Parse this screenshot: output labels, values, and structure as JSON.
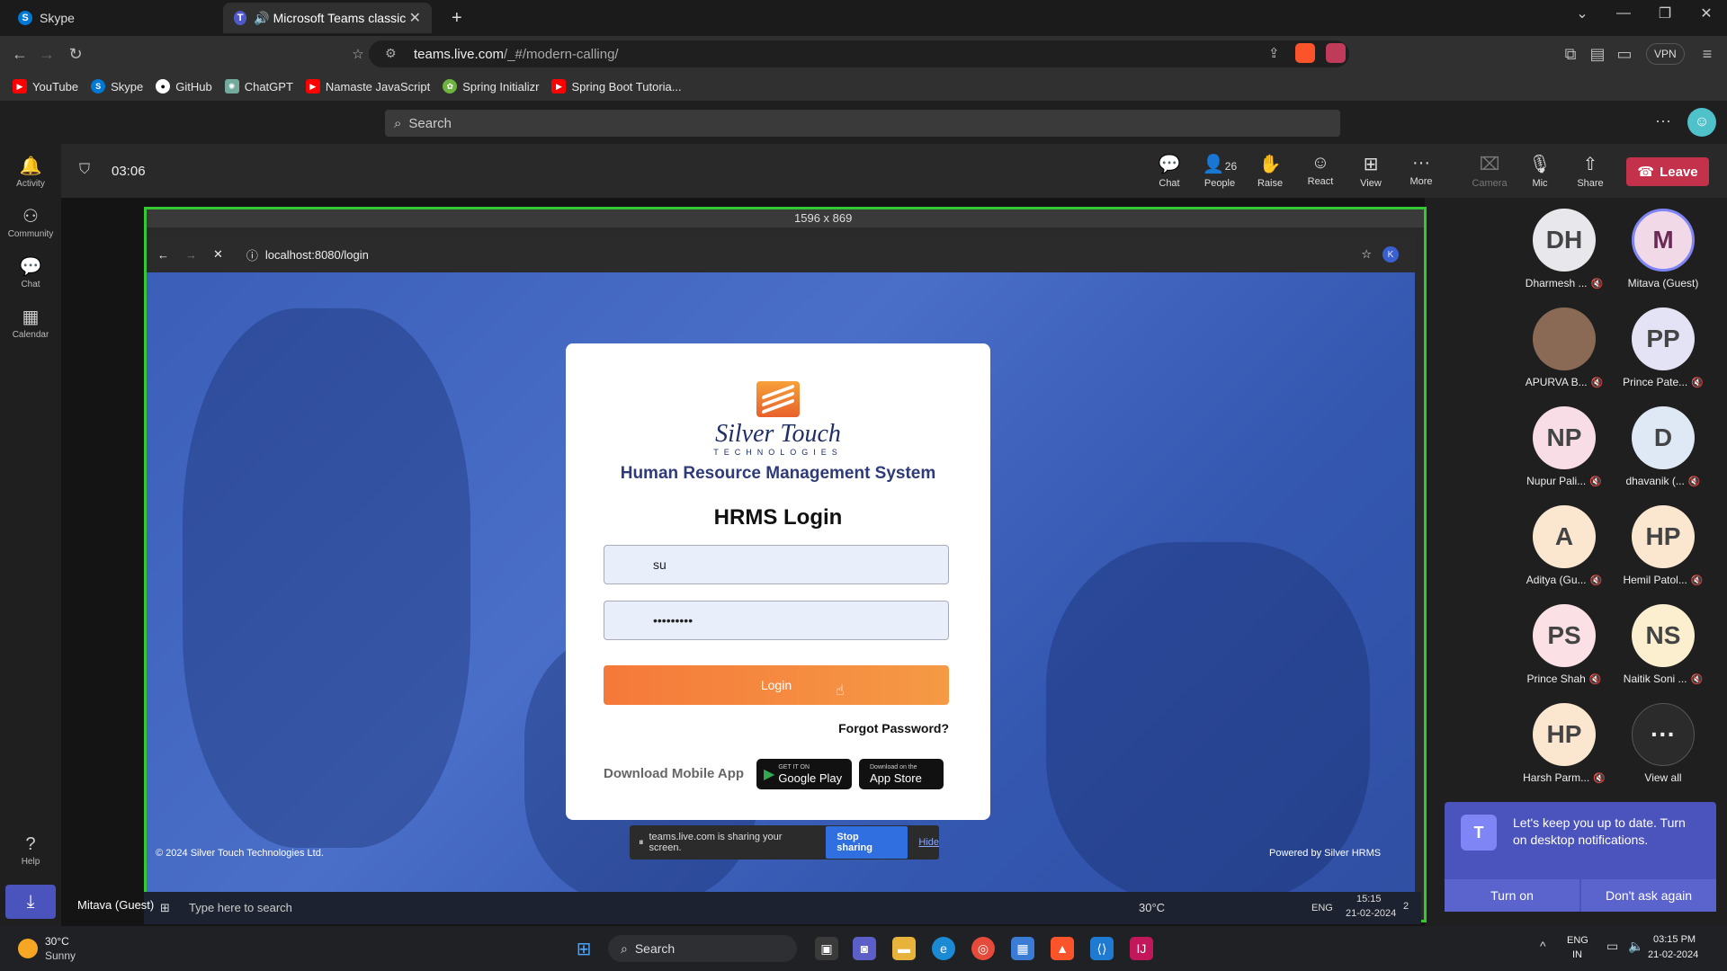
{
  "browser": {
    "tabs": [
      {
        "label": "Skype",
        "active": false
      },
      {
        "label": "Microsoft Teams classic - loa",
        "active": true
      }
    ],
    "url_host": "teams.live.com",
    "url_path": "/_#/modern-calling/",
    "vpn_label": "VPN",
    "bookmarks": [
      {
        "label": "YouTube",
        "icon": "youtube-icon",
        "color": "#ff0000"
      },
      {
        "label": "Skype",
        "icon": "skype-icon",
        "color": "#0078d4"
      },
      {
        "label": "GitHub",
        "icon": "github-icon",
        "color": "#ffffff"
      },
      {
        "label": "ChatGPT",
        "icon": "chatgpt-icon",
        "color": "#74aa9c"
      },
      {
        "label": "Namaste JavaScript",
        "icon": "youtube-icon",
        "color": "#ff0000"
      },
      {
        "label": "Spring Initializr",
        "icon": "spring-icon",
        "color": "#6db33f"
      },
      {
        "label": "Spring Boot Tutoria...",
        "icon": "youtube-icon",
        "color": "#ff0000"
      }
    ]
  },
  "teams": {
    "search_placeholder": "Search",
    "rail": [
      {
        "label": "Activity",
        "icon": "bell-icon"
      },
      {
        "label": "Community",
        "icon": "community-icon"
      },
      {
        "label": "Chat",
        "icon": "chat-icon"
      },
      {
        "label": "Calendar",
        "icon": "calendar-icon"
      }
    ],
    "rail_help": "Help",
    "meeting": {
      "timer": "03:06",
      "controls": [
        {
          "label": "Chat",
          "icon": "chat-icon"
        },
        {
          "label": "People",
          "icon": "people-icon",
          "count": "26"
        },
        {
          "label": "Raise",
          "icon": "hand-icon"
        },
        {
          "label": "React",
          "icon": "smile-icon"
        },
        {
          "label": "View",
          "icon": "grid-icon"
        },
        {
          "label": "More",
          "icon": "more-icon"
        },
        {
          "label": "Camera",
          "icon": "camera-off-icon"
        },
        {
          "label": "Mic",
          "icon": "mic-off-icon"
        },
        {
          "label": "Share",
          "icon": "share-icon"
        }
      ],
      "leave_label": "Leave"
    },
    "participants": [
      {
        "initials": "DH",
        "name": "Dharmesh ...",
        "color": "#e8e8ec"
      },
      {
        "initials": "M",
        "name": "Mitava (Guest)",
        "color": "#f2d9e8"
      },
      {
        "initials": "",
        "name": "APURVA B...",
        "color": "#8a6a55"
      },
      {
        "initials": "PP",
        "name": "Prince Pate...",
        "color": "#e3e3f5"
      },
      {
        "initials": "NP",
        "name": "Nupur Pali...",
        "color": "#f8dde6"
      },
      {
        "initials": "D",
        "name": "dhavanik (...",
        "color": "#dfe9f5"
      },
      {
        "initials": "A",
        "name": "Aditya (Gu...",
        "color": "#fbe7cf"
      },
      {
        "initials": "HP",
        "name": "Hemil Patol...",
        "color": "#fbe7cf"
      },
      {
        "initials": "PS",
        "name": "Prince Shah",
        "color": "#fbe1e6"
      },
      {
        "initials": "NS",
        "name": "Naitik Soni ...",
        "color": "#fbefd0"
      },
      {
        "initials": "HP",
        "name": "Harsh Parm...",
        "color": "#fbe7cf"
      },
      {
        "initials": "···",
        "name": "View all",
        "color": "#2b2b2b"
      }
    ],
    "notification": {
      "text": "Let's keep you up to date. Turn on desktop notifications.",
      "turn_on": "Turn on",
      "dont_ask": "Don't ask again"
    },
    "self_label": "Mitava (Guest)"
  },
  "shared_screen": {
    "dimensions": "1596 x 869",
    "inner_url": "localhost:8080/login",
    "inner_profile": "K",
    "copyright": "© 2024 Silver Touch Technologies Ltd.",
    "powered_by": "Powered by Silver HRMS",
    "login": {
      "brand": "Silver Touch",
      "brand_sub": "TECHNOLOGIES",
      "system_title": "Human Resource Management System",
      "heading": "HRMS Login",
      "username_value": "su",
      "password_value": "•••••••••",
      "login_label": "Login",
      "forgot_label": "Forgot Password?",
      "download_label": "Download Mobile App",
      "google_play_small": "GET IT ON",
      "google_play": "Google Play",
      "app_store_small": "Download on the",
      "app_store": "App Store"
    },
    "share_banner": {
      "text": "teams.live.com is sharing your screen.",
      "stop": "Stop sharing",
      "hide": "Hide"
    },
    "inner_taskbar": {
      "search_placeholder": "Type here to search",
      "weather": "30°C",
      "lang": "ENG",
      "time": "15:15",
      "date": "21-02-2024",
      "notif_count": "2"
    }
  },
  "taskbar": {
    "weather_temp": "30°C",
    "weather_desc": "Sunny",
    "search_label": "Search",
    "lang_line1": "ENG",
    "lang_line2": "IN",
    "time": "03:15 PM",
    "date": "21-02-2024"
  }
}
